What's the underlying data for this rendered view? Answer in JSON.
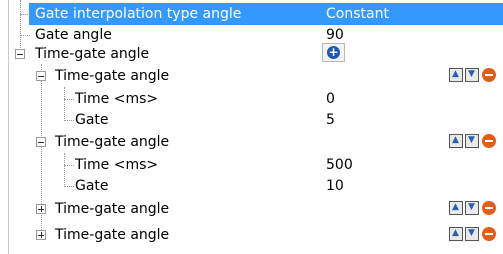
{
  "rows": [
    {
      "label": "Gate interpolation type angle",
      "value": "Constant"
    },
    {
      "label": "Gate angle",
      "value": "90"
    },
    {
      "label": "Time-gate angle"
    },
    {
      "label": "Time-gate angle"
    },
    {
      "label": "Time <ms>",
      "value": "0"
    },
    {
      "label": "Gate",
      "value": "5"
    },
    {
      "label": "Time-gate angle"
    },
    {
      "label": "Time <ms>",
      "value": "500"
    },
    {
      "label": "Gate",
      "value": "10"
    },
    {
      "label": "Time-gate angle"
    },
    {
      "label": "Time-gate angle"
    }
  ],
  "icons": {
    "add": "plus-circle-icon",
    "move_up": "move-up-icon",
    "move_down": "move-down-icon",
    "delete": "delete-icon"
  },
  "colors": {
    "selection": "#3399ff",
    "add_button": "#1a57b8",
    "delete": "#e25d16"
  }
}
